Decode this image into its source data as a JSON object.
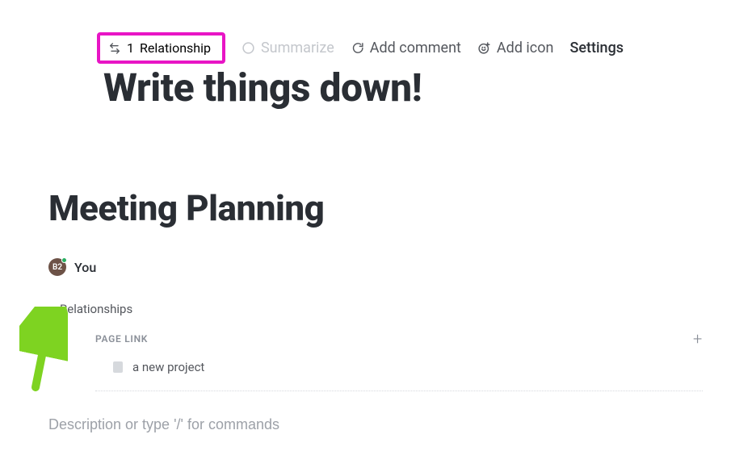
{
  "toolbar": {
    "relationship_count": "1",
    "relationship_label": "Relationship",
    "summarize": "Summarize",
    "add_comment": "Add comment",
    "add_icon": "Add icon",
    "settings": "Settings"
  },
  "title": "Write things down!",
  "heading": "Meeting Planning",
  "author": {
    "avatar_text": "B2",
    "name": "You"
  },
  "relationships": {
    "label": "Relationships",
    "page_link_label": "PAGE LINK",
    "items": [
      {
        "label": "a new project"
      }
    ]
  },
  "description_placeholder": "Description or type '/' for commands"
}
